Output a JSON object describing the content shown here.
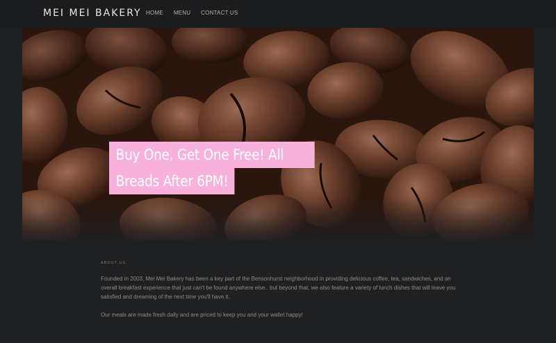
{
  "nav": {
    "brand": "MEI MEI BAKERY",
    "links": [
      "HOME",
      "MENU",
      "CONTACT US"
    ]
  },
  "hero": {
    "image_subject": "coffee beans",
    "promo_line1": "Buy One, Get One Free! All",
    "promo_line2": "Breads After 6PM!",
    "promo_bg_color": "#f6b1dc"
  },
  "about": {
    "heading": "ABOUT US",
    "paragraph1": "Founded in 2003, Mei Mei Bakery has been a key part of the Bensonhurst neighborhood in providing delicious coffee, tea, sandwiches, and an overall breakfast experience that just can't be found anywhere else.. but beyond that, we also feature a variety of lunch dishes that will leave you satisfied and dreaming of the next time you'll have it.",
    "paragraph2": "Our meals are made fresh daily and are priced to keep you and your wallet happy!"
  },
  "colors": {
    "page_bg": "#1f2022",
    "nav_bg": "#1b1c1e",
    "accent_pink": "#f6b1dc"
  }
}
